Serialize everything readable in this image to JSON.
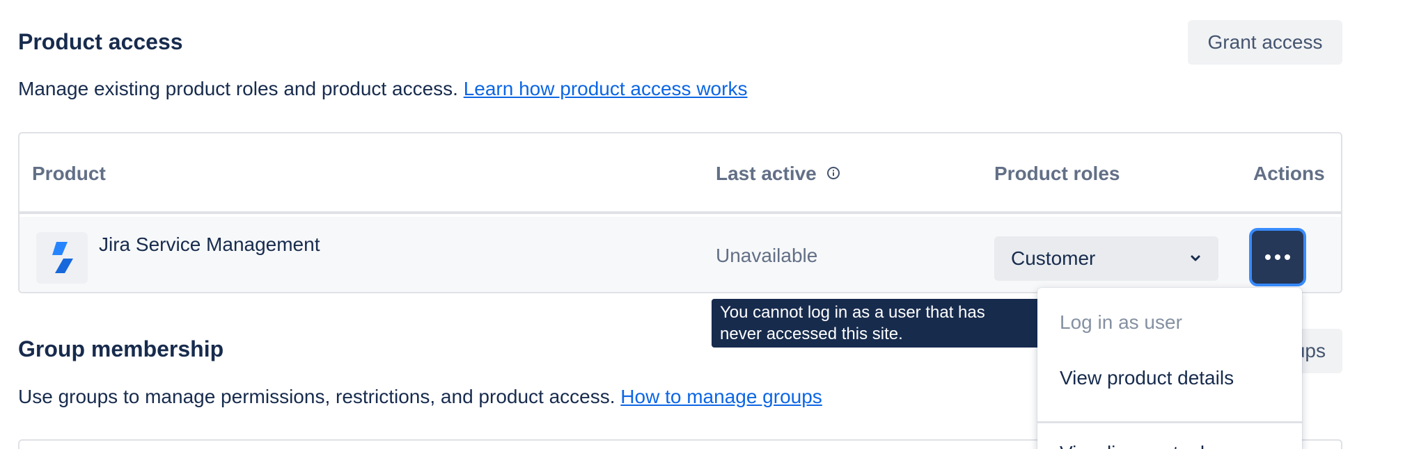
{
  "product_access": {
    "title": "Product access",
    "grant_button": "Grant access",
    "description": "Manage existing product roles and product access.",
    "learn_link": "Learn how product access works"
  },
  "table": {
    "headers": {
      "product": "Product",
      "last_active": "Last active",
      "product_roles": "Product roles",
      "actions": "Actions"
    },
    "row": {
      "product": "Jira Service Management",
      "last_active": "Unavailable",
      "role": "Customer"
    }
  },
  "tooltip": {
    "line1": "You cannot log in as a user that has",
    "line2": "never accessed this site."
  },
  "menu": {
    "items": [
      "Log in as user",
      "View product details",
      "View license tools"
    ]
  },
  "group_membership": {
    "title": "Group membership",
    "button_partial": "ups",
    "description": "Use groups to manage permissions, restrictions, and product access.",
    "manage_link": "How to manage groups"
  },
  "colors": {
    "link": "#0c66e4",
    "brand_icon": "#2684ff",
    "actions_button": "#253858",
    "focus_ring": "#388bff"
  }
}
